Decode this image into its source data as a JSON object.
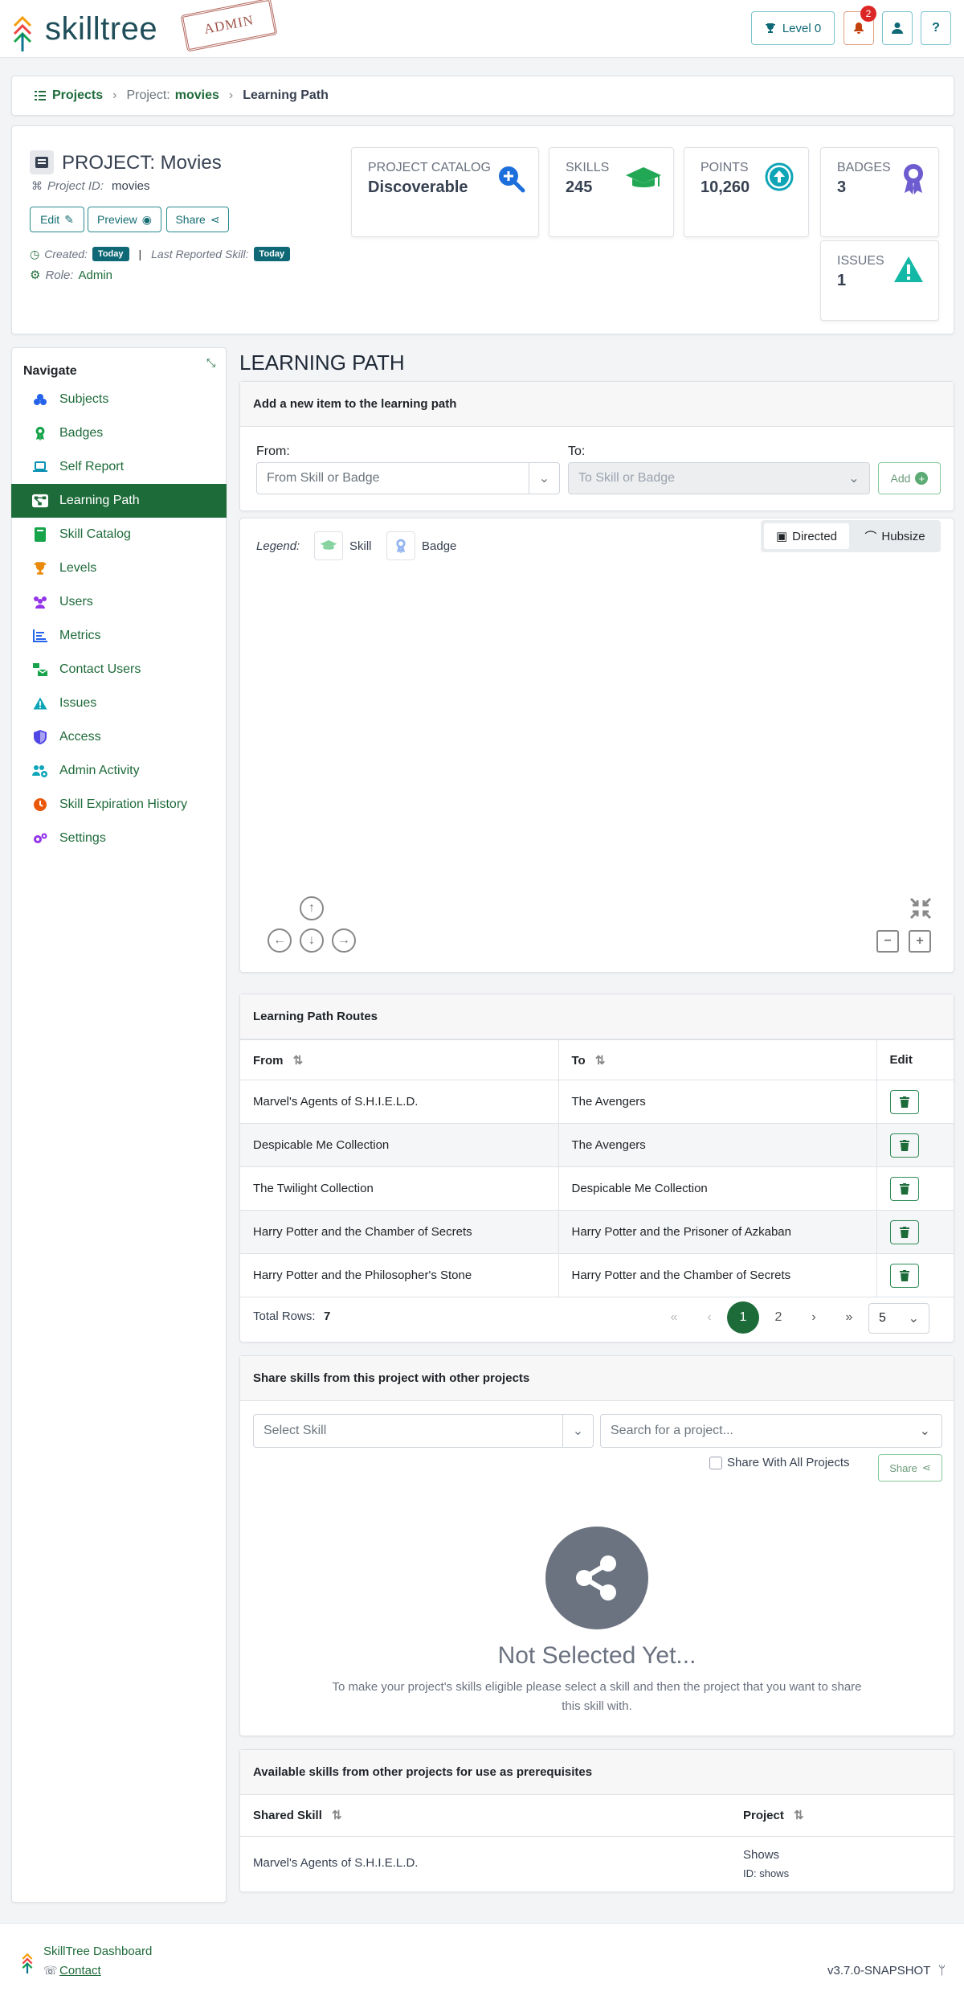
{
  "header": {
    "brand": "skilltree",
    "stamp": "ADMIN",
    "level_label": "Level 0",
    "notif_count": "2",
    "help": "?"
  },
  "breadcrumb": {
    "projects": "Projects",
    "project_prefix": "Project:",
    "project_name": "movies",
    "current": "Learning Path"
  },
  "project": {
    "title": "PROJECT: Movies",
    "id_label": "Project ID:",
    "id_value": "movies",
    "edit": "Edit",
    "preview": "Preview",
    "share": "Share",
    "created_label": "Created:",
    "created_value": "Today",
    "separator": "|",
    "last_label": "Last Reported Skill:",
    "last_value": "Today",
    "role_label": "Role:",
    "role_value": "Admin"
  },
  "stats": [
    {
      "label": "PROJECT CATALOG",
      "value": "Discoverable",
      "icon": "search-plus-icon"
    },
    {
      "label": "SKILLS",
      "value": "245",
      "icon": "graduation-cap-icon"
    },
    {
      "label": "POINTS",
      "value": "10,260",
      "icon": "arrow-up-circle-icon"
    },
    {
      "label": "BADGES",
      "value": "3",
      "icon": "award-icon"
    },
    {
      "label": "ISSUES",
      "value": "1",
      "icon": "warning-icon"
    }
  ],
  "nav": {
    "title": "Navigate",
    "items": [
      {
        "label": "Subjects",
        "icon": "cubes-icon",
        "color": "#2563eb"
      },
      {
        "label": "Badges",
        "icon": "award-icon",
        "color": "#16a34a"
      },
      {
        "label": "Self Report",
        "icon": "laptop-icon",
        "color": "#0891b2"
      },
      {
        "label": "Learning Path",
        "icon": "network-icon",
        "color": "#ffffff"
      },
      {
        "label": "Skill Catalog",
        "icon": "book-icon",
        "color": "#16a34a"
      },
      {
        "label": "Levels",
        "icon": "trophy-icon",
        "color": "#ea8a0c"
      },
      {
        "label": "Users",
        "icon": "users-icon",
        "color": "#9333ea"
      },
      {
        "label": "Metrics",
        "icon": "chart-icon",
        "color": "#2563eb"
      },
      {
        "label": "Contact Users",
        "icon": "mail-bulk-icon",
        "color": "#16a34a"
      },
      {
        "label": "Issues",
        "icon": "warning-icon",
        "color": "#0ea5b7"
      },
      {
        "label": "Access",
        "icon": "shield-icon",
        "color": "#4f46e5"
      },
      {
        "label": "Admin Activity",
        "icon": "users-cog-icon",
        "color": "#0ea5b7"
      },
      {
        "label": "Skill Expiration History",
        "icon": "clock-icon",
        "color": "#ea580c"
      },
      {
        "label": "Settings",
        "icon": "cogs-icon",
        "color": "#9333ea"
      }
    ]
  },
  "page_title": "LEARNING PATH",
  "add_item": {
    "header": "Add a new item to the learning path",
    "from_label": "From:",
    "from_placeholder": "From Skill or Badge",
    "to_label": "To:",
    "to_placeholder": "To Skill or Badge",
    "add": "Add"
  },
  "graph": {
    "legend_label": "Legend:",
    "skill": "Skill",
    "badge": "Badge",
    "directed": "Directed",
    "hubsize": "Hubsize"
  },
  "routes": {
    "header": "Learning Path Routes",
    "col_from": "From",
    "col_to": "To",
    "col_edit": "Edit",
    "rows": [
      {
        "from": "Marvel's Agents of S.H.I.E.L.D.",
        "to": "The Avengers"
      },
      {
        "from": "Despicable Me Collection",
        "to": "The Avengers"
      },
      {
        "from": "The Twilight Collection",
        "to": "Despicable Me Collection"
      },
      {
        "from": "Harry Potter and the Chamber of Secrets",
        "to": "Harry Potter and the Prisoner of Azkaban"
      },
      {
        "from": "Harry Potter and the Philosopher's Stone",
        "to": "Harry Potter and the Chamber of Secrets"
      }
    ],
    "total_label": "Total Rows:",
    "total_value": "7",
    "page1": "1",
    "page2": "2",
    "page_size": "5"
  },
  "share": {
    "header": "Share skills from this project with other projects",
    "select_skill": "Select Skill",
    "search_project": "Search for a project...",
    "share_all": "Share With All Projects",
    "share_btn": "Share",
    "empty_title": "Not Selected Yet...",
    "empty_text": "To make your project's skills eligible please select a skill and then the project that you want to share this skill with."
  },
  "available": {
    "header": "Available skills from other projects for use as prerequisites",
    "col_skill": "Shared Skill",
    "col_project": "Project",
    "row_skill": "Marvel's Agents of S.H.I.E.L.D.",
    "row_project": "Shows",
    "row_project_id": "ID: shows"
  },
  "footer": {
    "dashboard": "SkillTree Dashboard",
    "contact": "Contact",
    "version": "v3.7.0-SNAPSHOT"
  }
}
